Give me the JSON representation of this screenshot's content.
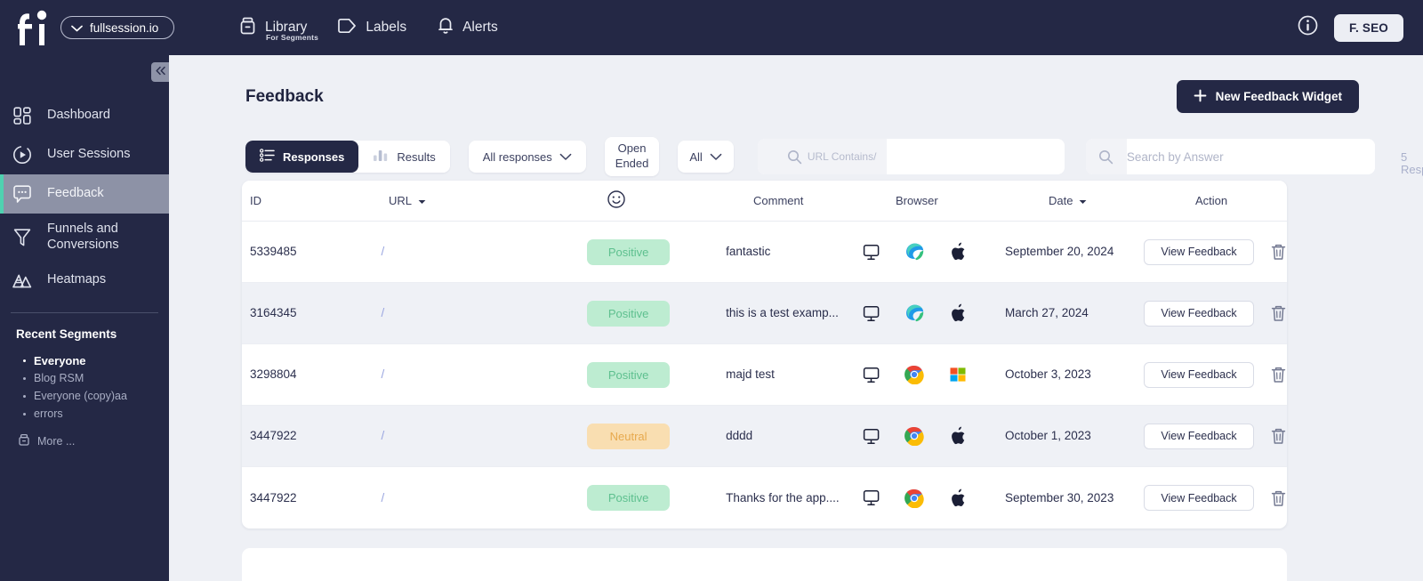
{
  "topbar": {
    "logo_text": "fi",
    "org_selector": {
      "label": "fullsession.io",
      "icon": "chevron-down-icon"
    },
    "nav": [
      {
        "label": "Library",
        "sub": "For Segments",
        "icon": "library-box-icon"
      },
      {
        "label": "Labels",
        "sub": "",
        "icon": "tag-icon"
      },
      {
        "label": "Alerts",
        "sub": "",
        "icon": "bell-icon"
      }
    ],
    "info_icon": "info-circle-icon",
    "account_button": "F. SEO"
  },
  "sidebar": {
    "collapse_icon": "chevron-double-left-icon",
    "items": [
      {
        "label": "Dashboard",
        "icon": "dashboard-grid-icon",
        "active": false
      },
      {
        "label": "User Sessions",
        "icon": "play-circle-icon",
        "active": false
      },
      {
        "label": "Feedback",
        "icon": "chat-bubble-icon",
        "active": true
      },
      {
        "label": "Funnels and Conversions",
        "icon": "funnel-icon",
        "active": false
      },
      {
        "label": "Heatmaps",
        "icon": "heatmap-mountain-icon",
        "active": false
      }
    ],
    "segments_title": "Recent Segments",
    "segments": [
      {
        "label": "Everyone",
        "bold": true
      },
      {
        "label": "Blog RSM",
        "bold": false
      },
      {
        "label": "Everyone (copy)aa",
        "bold": false
      },
      {
        "label": "errors",
        "bold": false
      }
    ],
    "more_label": "More ...",
    "more_icon": "library-box-icon",
    "active_accent": "#4fd1b0"
  },
  "page": {
    "title": "Feedback",
    "new_widget_button": {
      "label": "New Feedback Widget",
      "icon": "plus-icon"
    }
  },
  "toolbar": {
    "tabs": [
      {
        "label": "Responses",
        "icon": "list-icon",
        "selected": true
      },
      {
        "label": "Results",
        "icon": "bar-chart-icon",
        "selected": false
      }
    ],
    "filters": [
      {
        "label": "All responses",
        "icon": "chevron-down-icon",
        "type": "dropdown"
      },
      {
        "label_line1": "Open",
        "label_line2": "Ended",
        "type": "pill"
      },
      {
        "label": "All",
        "icon": "chevron-down-icon",
        "type": "dropdown"
      }
    ],
    "url_search": {
      "icon": "search-icon",
      "prefix": "URL Contains/",
      "value": ""
    },
    "answer_search": {
      "icon": "search-icon",
      "placeholder": "Search by Answer",
      "value": ""
    },
    "response_count_number": "5",
    "response_count_label": "Responses"
  },
  "table": {
    "columns": [
      {
        "label": "ID",
        "sortable": false
      },
      {
        "label": "URL",
        "sortable": true
      },
      {
        "label": "",
        "icon": "smiley-face-icon",
        "sortable": false
      },
      {
        "label": "Comment",
        "sortable": false
      },
      {
        "label": "Browser",
        "sortable": false
      },
      {
        "label": "Date",
        "sortable": true
      },
      {
        "label": "Action",
        "sortable": false
      }
    ],
    "rows": [
      {
        "id": "5339485",
        "url": "/",
        "sentiment": "Positive",
        "sentiment_type": "pos",
        "comment": "fantastic",
        "browsers": [
          "desktop-monitor-icon",
          "edge-browser-icon",
          "apple-icon"
        ],
        "date": "September 20, 2024",
        "action_label": "View Feedback",
        "delete_icon": "trash-icon"
      },
      {
        "id": "3164345",
        "url": "/",
        "sentiment": "Positive",
        "sentiment_type": "pos",
        "comment": "this is a test examp...",
        "browsers": [
          "desktop-monitor-icon",
          "edge-browser-icon",
          "apple-icon"
        ],
        "date": "March 27, 2024",
        "action_label": "View Feedback",
        "delete_icon": "trash-icon"
      },
      {
        "id": "3298804",
        "url": "/",
        "sentiment": "Positive",
        "sentiment_type": "pos",
        "comment": "majd test",
        "browsers": [
          "desktop-monitor-icon",
          "chrome-browser-icon",
          "windows-icon"
        ],
        "date": "October 3, 2023",
        "action_label": "View Feedback",
        "delete_icon": "trash-icon"
      },
      {
        "id": "3447922",
        "url": "/",
        "sentiment": "Neutral",
        "sentiment_type": "neu",
        "comment": "dddd",
        "browsers": [
          "desktop-monitor-icon",
          "chrome-browser-icon",
          "apple-icon"
        ],
        "date": "October 1, 2023",
        "action_label": "View Feedback",
        "delete_icon": "trash-icon"
      },
      {
        "id": "3447922",
        "url": "/",
        "sentiment": "Positive",
        "sentiment_type": "pos",
        "comment": "Thanks for the app....",
        "browsers": [
          "desktop-monitor-icon",
          "chrome-browser-icon",
          "apple-icon"
        ],
        "date": "September 30, 2023",
        "action_label": "View Feedback",
        "delete_icon": "trash-icon"
      }
    ]
  },
  "colors": {
    "navy": "#242845",
    "page_bg": "#eef0f5",
    "accent_teal": "#4fd1b0",
    "positive_bg": "#bdecd1",
    "positive_text": "#5ec08f",
    "neutral_bg": "#f9deb1",
    "neutral_text": "#e7a94e",
    "url_link": "#9aa6e0"
  }
}
